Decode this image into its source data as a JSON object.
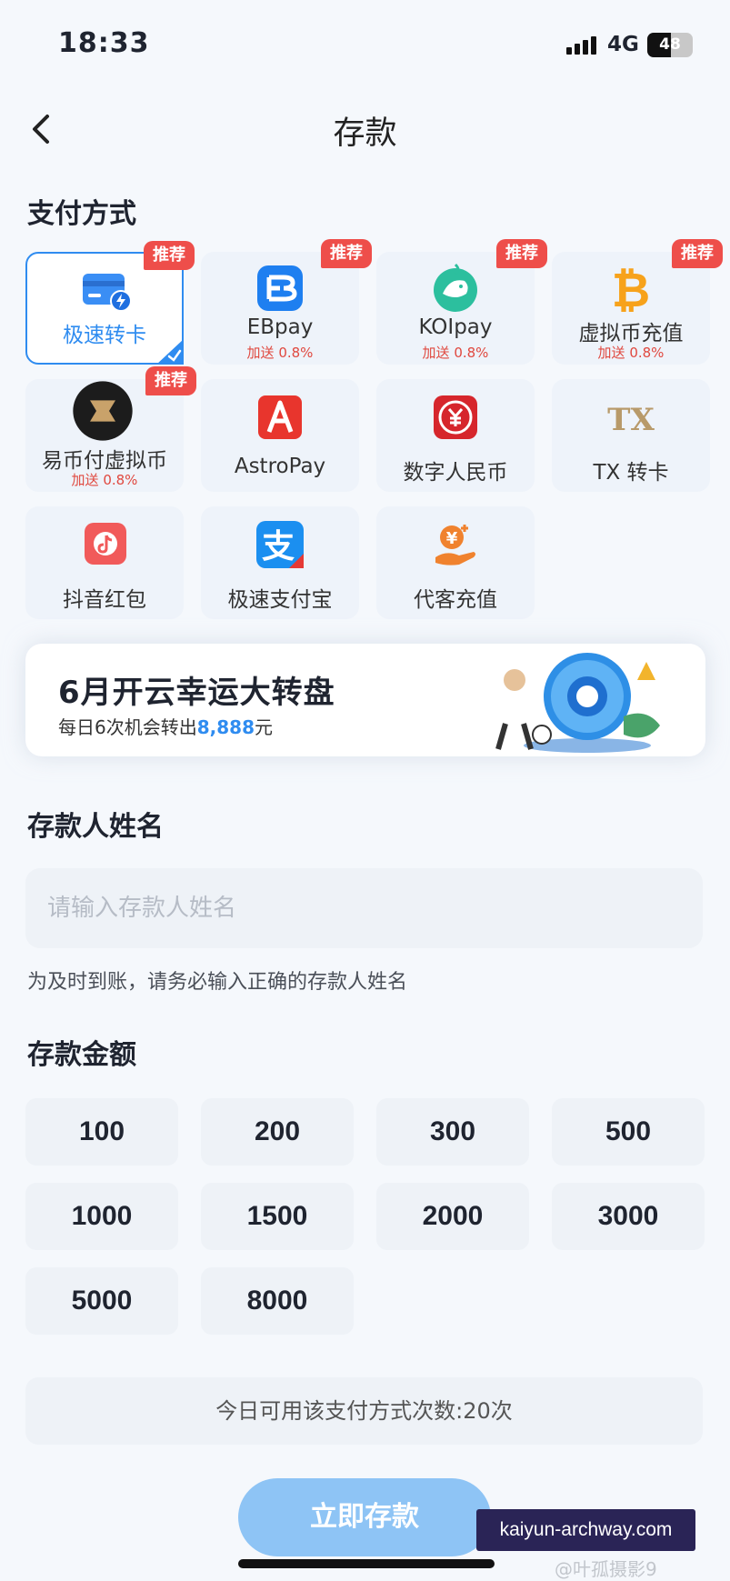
{
  "status_bar": {
    "time": "18:33",
    "network": "4G",
    "battery": "48"
  },
  "nav": {
    "title": "存款"
  },
  "payment_section": {
    "title": "支付方式",
    "methods": [
      {
        "name": "极速转卡",
        "badge": "推荐",
        "bonus": "",
        "selected": true,
        "icon": "card-flash-icon"
      },
      {
        "name": "EBpay",
        "badge": "推荐",
        "bonus": "加送 0.8%",
        "selected": false,
        "icon": "ebpay-icon"
      },
      {
        "name": "KOIpay",
        "badge": "推荐",
        "bonus": "加送 0.8%",
        "selected": false,
        "icon": "koi-fish-icon"
      },
      {
        "name": "虚拟币充值",
        "badge": "推荐",
        "bonus": "加送 0.8%",
        "selected": false,
        "icon": "bitcoin-icon"
      },
      {
        "name": "易币付虚拟币",
        "badge": "推荐",
        "bonus": "加送 0.8%",
        "selected": false,
        "icon": "yibifu-icon"
      },
      {
        "name": "AstroPay",
        "badge": "",
        "bonus": "",
        "selected": false,
        "icon": "astropay-icon"
      },
      {
        "name": "数字人民币",
        "badge": "",
        "bonus": "",
        "selected": false,
        "icon": "digital-rmb-icon"
      },
      {
        "name": "TX 转卡",
        "badge": "",
        "bonus": "",
        "selected": false,
        "icon": "tx-icon"
      },
      {
        "name": "抖音红包",
        "badge": "",
        "bonus": "",
        "selected": false,
        "icon": "douyin-redpacket-icon"
      },
      {
        "name": "极速支付宝",
        "badge": "",
        "bonus": "",
        "selected": false,
        "icon": "alipay-icon"
      },
      {
        "name": "代客充值",
        "badge": "",
        "bonus": "",
        "selected": false,
        "icon": "agent-topup-icon"
      }
    ]
  },
  "banner": {
    "title": "6月开云幸运大转盘",
    "sub_prefix": "每日6次机会转出",
    "sub_amount": "8,888",
    "sub_suffix": "元"
  },
  "depositor": {
    "title": "存款人姓名",
    "placeholder": "请输入存款人姓名",
    "hint": "为及时到账，请务必输入正确的存款人姓名"
  },
  "amount": {
    "title": "存款金额",
    "options": [
      "100",
      "200",
      "300",
      "500",
      "1000",
      "1500",
      "2000",
      "3000",
      "5000",
      "8000"
    ]
  },
  "usage_text": "今日可用该支付方式次数:20次",
  "submit_label": "立即存款",
  "watermark": {
    "site": "kaiyun-archway.com",
    "tail": "@叶孤摄影9"
  },
  "colors": {
    "accent": "#2f8cf0",
    "badge": "#ee4e4a",
    "bonus": "#e0483f",
    "submit": "#8ec4f5"
  }
}
